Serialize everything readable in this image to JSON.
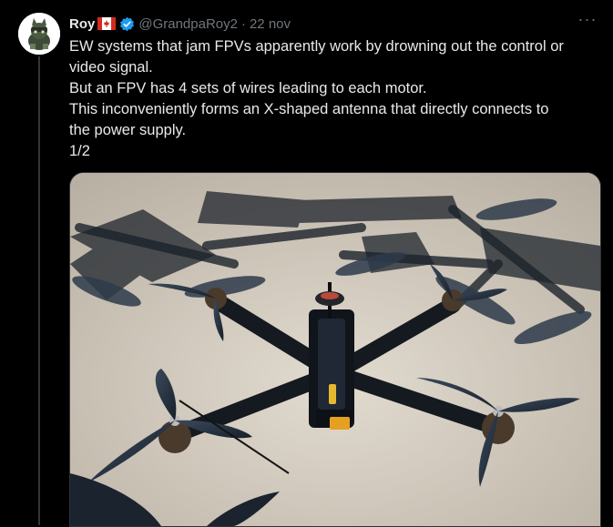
{
  "tweet": {
    "display_name": "Roy",
    "flag_icon": "canada-flag-icon",
    "verified_icon": "verified-badge-icon",
    "handle": "@GrandpaRoy2",
    "separator": "·",
    "date": "22 nov",
    "more_icon": "more-horizontal-icon",
    "more_label": "···",
    "lines": [
      "EW systems that jam FPVs apparently work by drowning out the control or",
      "video signal.",
      "But an FPV has 4 sets of wires leading to each motor.",
      "This inconveniently forms an X-shaped antenna that directly connects to",
      "the power supply.",
      "1/2"
    ]
  },
  "colors": {
    "background": "#000000",
    "text": "#e7e9ea",
    "muted": "#71767b",
    "verified": "#1d9bf0",
    "thread_line": "#333639"
  }
}
